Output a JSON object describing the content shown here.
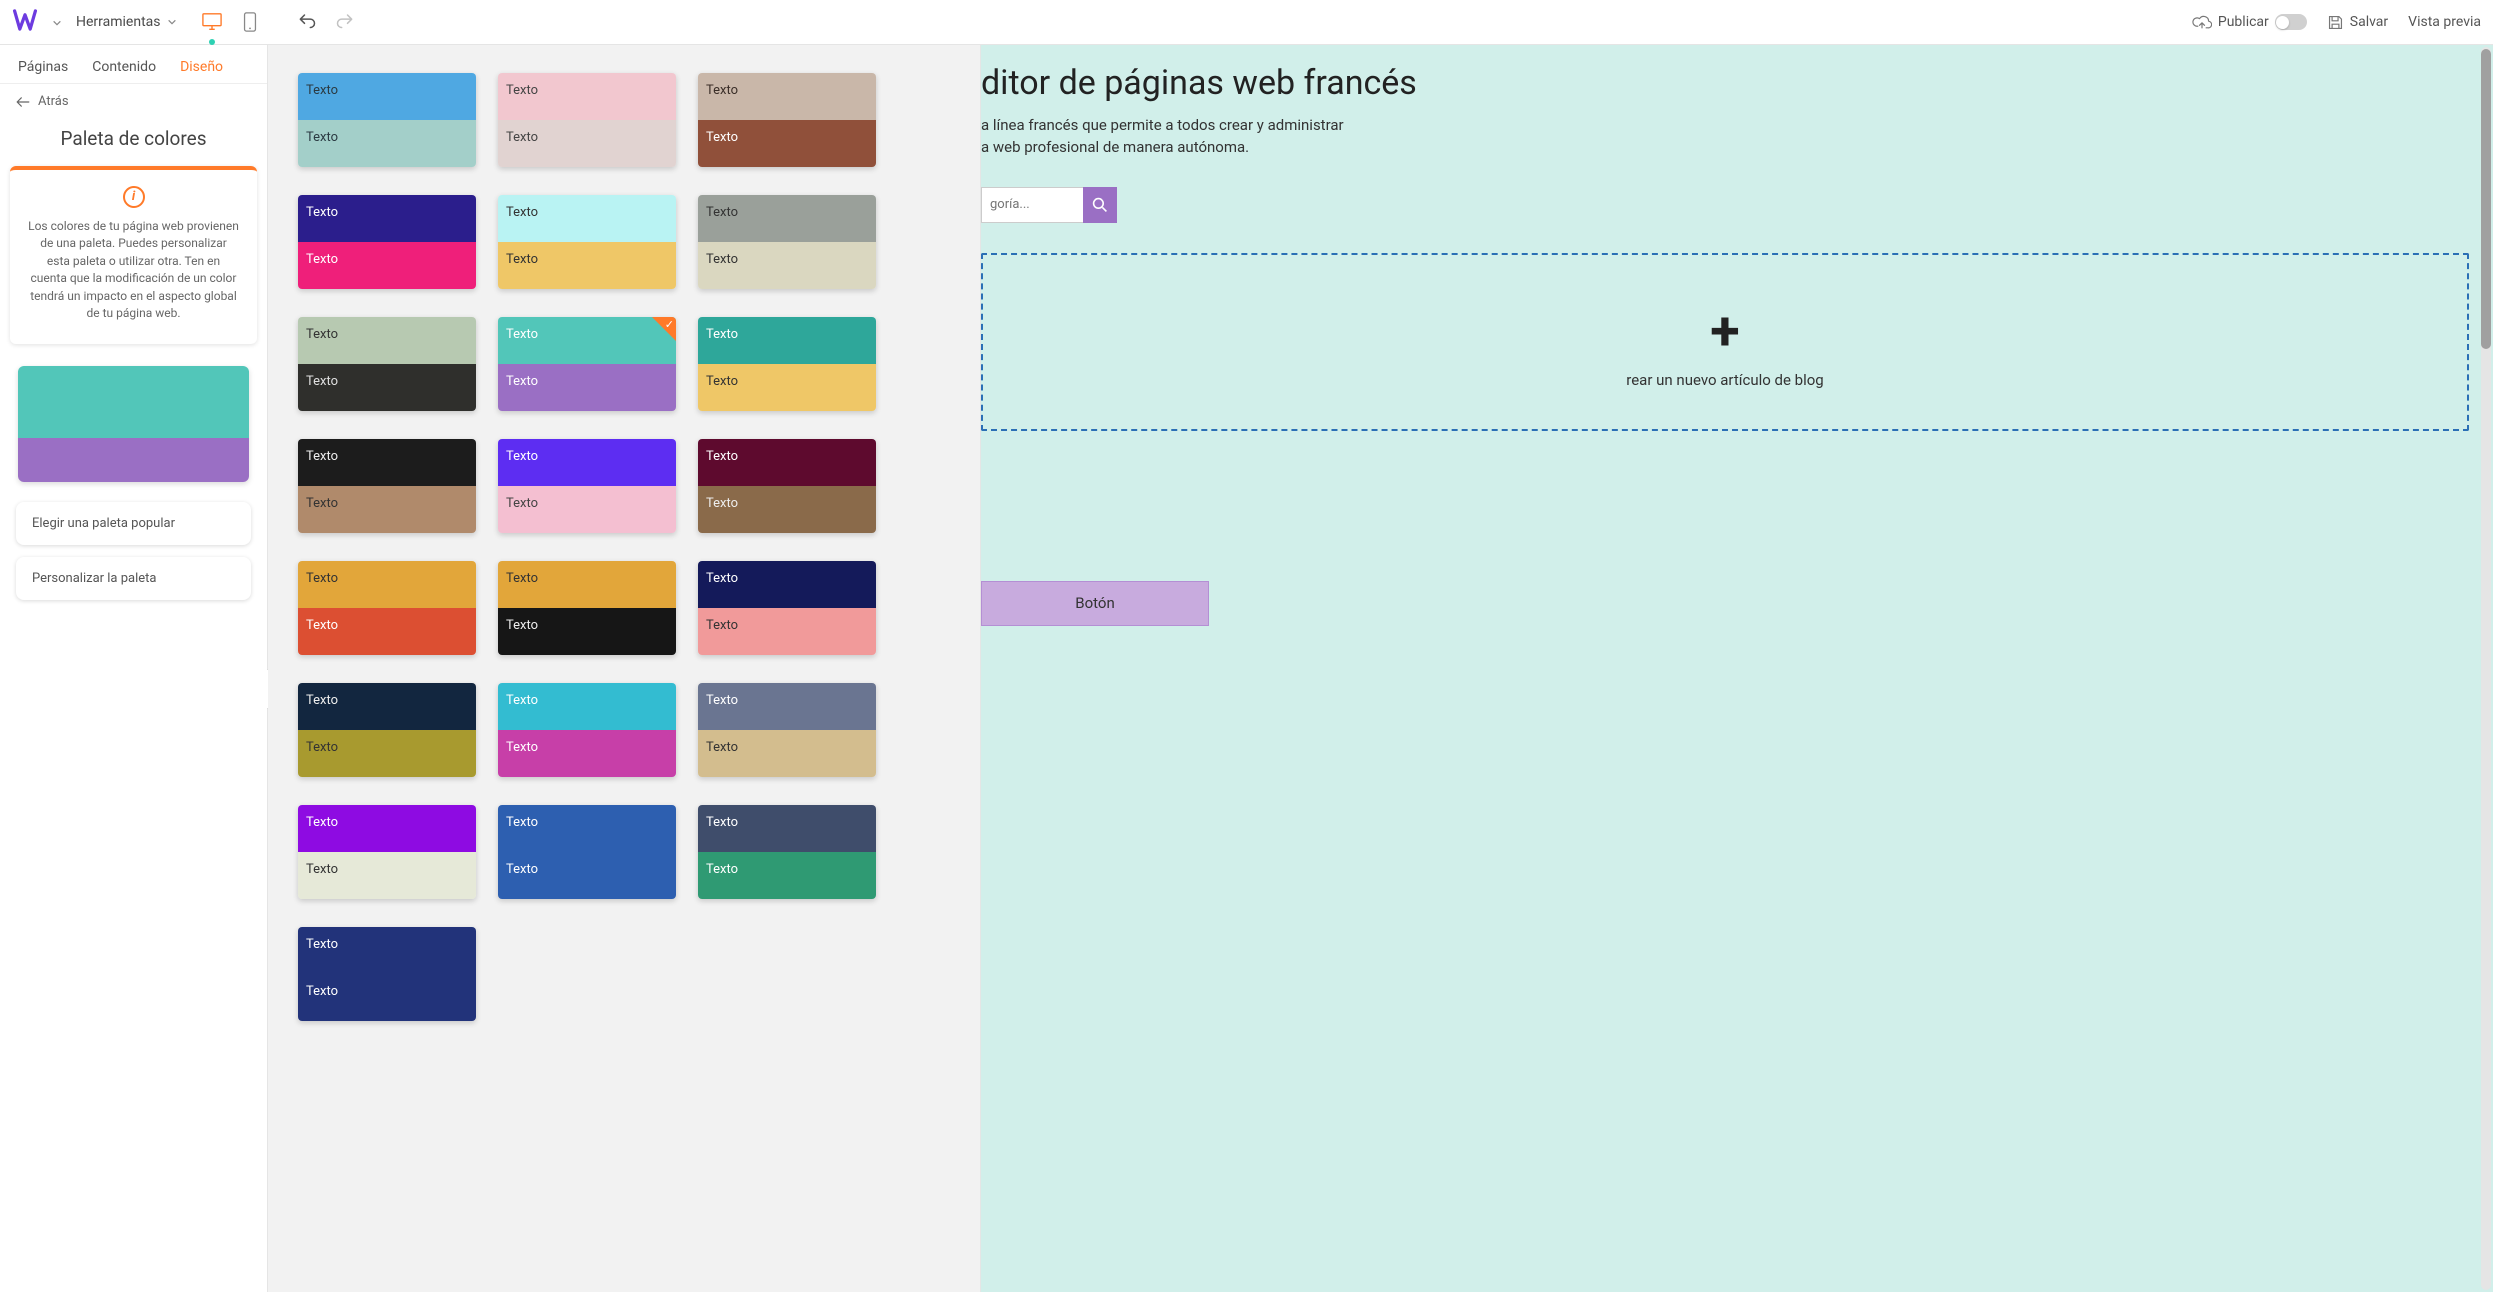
{
  "topbar": {
    "tools_label": "Herramientas",
    "publish_label": "Publicar",
    "save_label": "Salvar",
    "preview_label": "Vista previa"
  },
  "sidebar": {
    "tabs": {
      "pages": "Páginas",
      "content": "Contenido",
      "design": "Diseño"
    },
    "back_label": "Atrás",
    "panel_title": "Paleta de colores",
    "info_text": "Los colores de tu página web provienen de una paleta. Puedes personalizar esta paleta o utilizar otra. Ten en cuenta que la modificación de un color tendrá un impacto en el aspecto global de tu página web.",
    "btn_popular": "Elegir una paleta popular",
    "btn_custom": "Personalizar la paleta",
    "current_palette": {
      "top": "#52c6b9",
      "bottom": "#9a6fc4"
    }
  },
  "swatch_label": "Texto",
  "palettes": [
    [
      {
        "bg": "#4fa8e2",
        "fg": "#2b3a42"
      },
      {
        "bg": "#a3cfc9",
        "fg": "#2b3a42"
      }
    ],
    [
      {
        "bg": "#f2c7cf",
        "fg": "#444"
      },
      {
        "bg": "#e1d3d1",
        "fg": "#444"
      }
    ],
    [
      {
        "bg": "#c9b7a9",
        "fg": "#3a2e28"
      },
      {
        "bg": "#90503a",
        "fg": "#fff"
      }
    ],
    [
      {
        "bg": "#2b1e8c",
        "fg": "#fff"
      },
      {
        "bg": "#ef1f7a",
        "fg": "#fff"
      }
    ],
    [
      {
        "bg": "#b9f3f3",
        "fg": "#333"
      },
      {
        "bg": "#efc767",
        "fg": "#333"
      }
    ],
    [
      {
        "bg": "#9aa09a",
        "fg": "#333"
      },
      {
        "bg": "#dad7c0",
        "fg": "#333"
      }
    ],
    [
      {
        "bg": "#b7c9b1",
        "fg": "#333"
      },
      {
        "bg": "#2f2f2c",
        "fg": "#e0e0e0"
      }
    ],
    [
      {
        "bg": "#52c6b9",
        "fg": "#fff"
      },
      {
        "bg": "#9a6fc4",
        "fg": "#fff"
      },
      {
        "selected": true
      }
    ],
    [
      {
        "bg": "#2ea79a",
        "fg": "#fff"
      },
      {
        "bg": "#efc767",
        "fg": "#333"
      }
    ],
    [
      {
        "bg": "#1c1c1c",
        "fg": "#eee"
      },
      {
        "bg": "#b08a6b",
        "fg": "#333"
      }
    ],
    [
      {
        "bg": "#5d2df2",
        "fg": "#fff"
      },
      {
        "bg": "#f4bfd1",
        "fg": "#444"
      }
    ],
    [
      {
        "bg": "#5e0a2e",
        "fg": "#fff"
      },
      {
        "bg": "#8a6a4a",
        "fg": "#eee"
      }
    ],
    [
      {
        "bg": "#e2a63a",
        "fg": "#333"
      },
      {
        "bg": "#dc4f32",
        "fg": "#fff"
      }
    ],
    [
      {
        "bg": "#e2a63a",
        "fg": "#333"
      },
      {
        "bg": "#161616",
        "fg": "#eee"
      }
    ],
    [
      {
        "bg": "#141a5a",
        "fg": "#fff"
      },
      {
        "bg": "#f19a9a",
        "fg": "#333"
      }
    ],
    [
      {
        "bg": "#12263f",
        "fg": "#eee"
      },
      {
        "bg": "#a89a2f",
        "fg": "#333"
      }
    ],
    [
      {
        "bg": "#33bcd1",
        "fg": "#fff"
      },
      {
        "bg": "#c73fa8",
        "fg": "#fff"
      }
    ],
    [
      {
        "bg": "#6a7591",
        "fg": "#fff"
      },
      {
        "bg": "#d3bd8e",
        "fg": "#333"
      }
    ],
    [
      {
        "bg": "#8e0be2",
        "fg": "#fff"
      },
      {
        "bg": "#e6e9d8",
        "fg": "#333"
      }
    ],
    [
      {
        "bg": "#2d5fb0",
        "fg": "#fff"
      },
      {
        "bg": "#2d5fb0",
        "fg": "#fff"
      }
    ],
    [
      {
        "bg": "#3f4d6b",
        "fg": "#fff"
      },
      {
        "bg": "#2f9a73",
        "fg": "#fff"
      }
    ],
    [
      {
        "bg": "#22337a",
        "fg": "#fff"
      },
      {
        "bg": "#22337a",
        "fg": "#fff"
      }
    ]
  ],
  "preview": {
    "title_partial": "ditor de páginas web francés",
    "desc_line1": "a línea francés que permite a todos crear y administrar",
    "desc_line2": "a web profesional de manera autónoma.",
    "search_placeholder": "goría...",
    "new_article": "rear un nuevo artículo de blog",
    "button_label": "Botón"
  }
}
